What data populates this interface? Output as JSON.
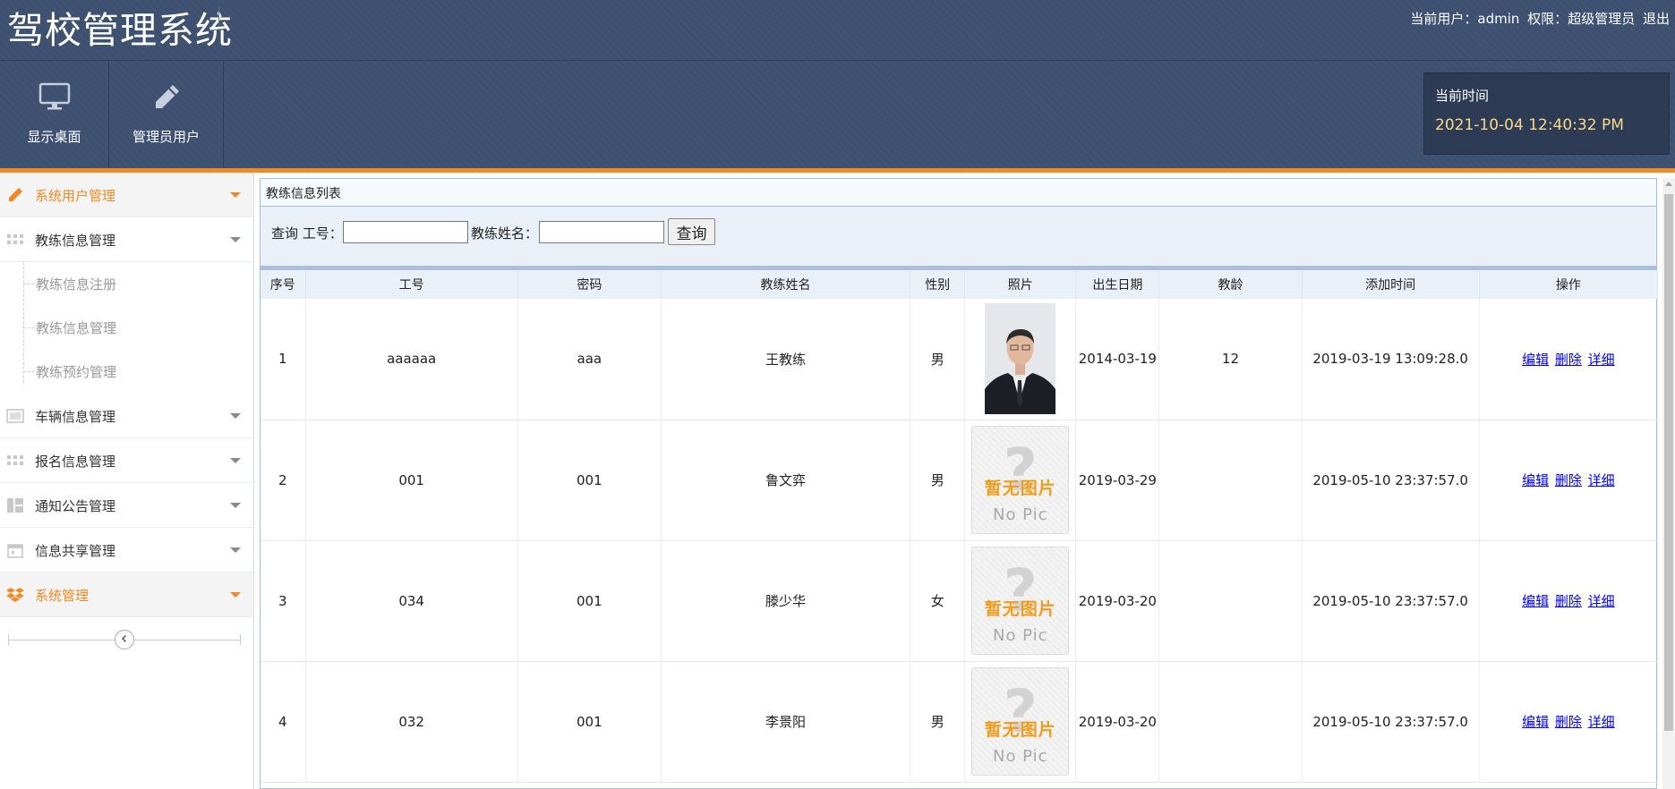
{
  "header": {
    "title": "驾校管理系统",
    "current_user_label": "当前用户：",
    "current_user": "admin",
    "permission_label": "权限：",
    "permission": "超级管理员",
    "logout": "退出"
  },
  "toolbar": {
    "desktop": {
      "label": "显示桌面",
      "icon": "monitor-icon"
    },
    "admin_user": {
      "label": "管理员用户",
      "icon": "pencil-icon"
    }
  },
  "clock": {
    "label": "当前时间",
    "value": "2021-10-04 12:40:32 PM"
  },
  "sidebar": {
    "items": [
      {
        "label": "系统用户管理",
        "icon": "pencil-icon"
      },
      {
        "label": "教练信息管理",
        "icon": "grid-icon"
      },
      {
        "label": "车辆信息管理",
        "icon": "image-icon"
      },
      {
        "label": "报名信息管理",
        "icon": "grid-icon"
      },
      {
        "label": "通知公告管理",
        "icon": "layout-icon"
      },
      {
        "label": "信息共享管理",
        "icon": "calendar-icon"
      },
      {
        "label": "系统管理",
        "icon": "dropbox-icon"
      }
    ],
    "submenu": [
      {
        "label": "教练信息注册"
      },
      {
        "label": "教练信息管理"
      },
      {
        "label": "教练预约管理"
      }
    ]
  },
  "panel": {
    "title": "教练信息列表",
    "search_label": "查询 工号：",
    "name_label": "教练姓名：",
    "job_no_value": "",
    "name_value": "",
    "search_button": "查询"
  },
  "table": {
    "columns": [
      "序号",
      "工号",
      "密码",
      "教练姓名",
      "性别",
      "照片",
      "出生日期",
      "教龄",
      "添加时间",
      "操作"
    ],
    "rows": [
      {
        "no": "1",
        "job_no": "aaaaaa",
        "password": "aaa",
        "name": "王教练",
        "gender": "男",
        "photo": "portrait",
        "dob": "2014-03-19",
        "experience": "12",
        "added": "2019-03-19 13:09:28.0"
      },
      {
        "no": "2",
        "job_no": "001",
        "password": "001",
        "name": "鲁文弈",
        "gender": "男",
        "photo": "nopic",
        "dob": "2019-03-29",
        "experience": "",
        "added": "2019-05-10 23:37:57.0"
      },
      {
        "no": "3",
        "job_no": "034",
        "password": "001",
        "name": "滕少华",
        "gender": "女",
        "photo": "nopic",
        "dob": "2019-03-20",
        "experience": "",
        "added": "2019-05-10 23:37:57.0"
      },
      {
        "no": "4",
        "job_no": "032",
        "password": "001",
        "name": "李景阳",
        "gender": "男",
        "photo": "nopic",
        "dob": "2019-03-20",
        "experience": "",
        "added": "2019-05-10 23:37:57.0"
      }
    ],
    "actions": {
      "edit": "编辑",
      "delete": "删除",
      "detail": "详细"
    },
    "nopic": {
      "cn": "暂无图片",
      "en": "No Pic"
    }
  },
  "colors": {
    "header_bg": "#3e5070",
    "accent": "#f08a24",
    "clock_value": "#f8d98a",
    "link": "#0000ee"
  }
}
